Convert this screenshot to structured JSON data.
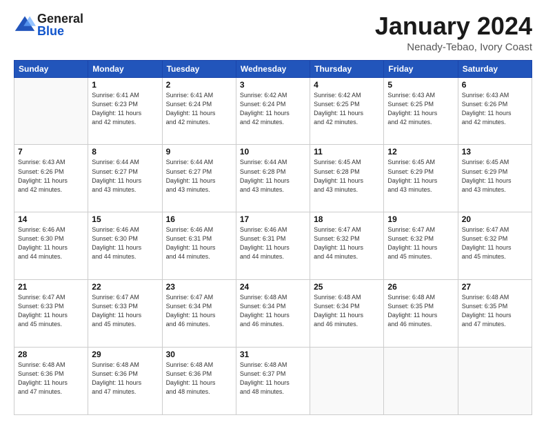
{
  "header": {
    "logo_general": "General",
    "logo_blue": "Blue",
    "month_title": "January 2024",
    "subtitle": "Nenady-Tebao, Ivory Coast"
  },
  "days_of_week": [
    "Sunday",
    "Monday",
    "Tuesday",
    "Wednesday",
    "Thursday",
    "Friday",
    "Saturday"
  ],
  "weeks": [
    [
      {
        "day": "",
        "info": ""
      },
      {
        "day": "1",
        "info": "Sunrise: 6:41 AM\nSunset: 6:23 PM\nDaylight: 11 hours\nand 42 minutes."
      },
      {
        "day": "2",
        "info": "Sunrise: 6:41 AM\nSunset: 6:24 PM\nDaylight: 11 hours\nand 42 minutes."
      },
      {
        "day": "3",
        "info": "Sunrise: 6:42 AM\nSunset: 6:24 PM\nDaylight: 11 hours\nand 42 minutes."
      },
      {
        "day": "4",
        "info": "Sunrise: 6:42 AM\nSunset: 6:25 PM\nDaylight: 11 hours\nand 42 minutes."
      },
      {
        "day": "5",
        "info": "Sunrise: 6:43 AM\nSunset: 6:25 PM\nDaylight: 11 hours\nand 42 minutes."
      },
      {
        "day": "6",
        "info": "Sunrise: 6:43 AM\nSunset: 6:26 PM\nDaylight: 11 hours\nand 42 minutes."
      }
    ],
    [
      {
        "day": "7",
        "info": "Sunrise: 6:43 AM\nSunset: 6:26 PM\nDaylight: 11 hours\nand 42 minutes."
      },
      {
        "day": "8",
        "info": "Sunrise: 6:44 AM\nSunset: 6:27 PM\nDaylight: 11 hours\nand 43 minutes."
      },
      {
        "day": "9",
        "info": "Sunrise: 6:44 AM\nSunset: 6:27 PM\nDaylight: 11 hours\nand 43 minutes."
      },
      {
        "day": "10",
        "info": "Sunrise: 6:44 AM\nSunset: 6:28 PM\nDaylight: 11 hours\nand 43 minutes."
      },
      {
        "day": "11",
        "info": "Sunrise: 6:45 AM\nSunset: 6:28 PM\nDaylight: 11 hours\nand 43 minutes."
      },
      {
        "day": "12",
        "info": "Sunrise: 6:45 AM\nSunset: 6:29 PM\nDaylight: 11 hours\nand 43 minutes."
      },
      {
        "day": "13",
        "info": "Sunrise: 6:45 AM\nSunset: 6:29 PM\nDaylight: 11 hours\nand 43 minutes."
      }
    ],
    [
      {
        "day": "14",
        "info": "Sunrise: 6:46 AM\nSunset: 6:30 PM\nDaylight: 11 hours\nand 44 minutes."
      },
      {
        "day": "15",
        "info": "Sunrise: 6:46 AM\nSunset: 6:30 PM\nDaylight: 11 hours\nand 44 minutes."
      },
      {
        "day": "16",
        "info": "Sunrise: 6:46 AM\nSunset: 6:31 PM\nDaylight: 11 hours\nand 44 minutes."
      },
      {
        "day": "17",
        "info": "Sunrise: 6:46 AM\nSunset: 6:31 PM\nDaylight: 11 hours\nand 44 minutes."
      },
      {
        "day": "18",
        "info": "Sunrise: 6:47 AM\nSunset: 6:32 PM\nDaylight: 11 hours\nand 44 minutes."
      },
      {
        "day": "19",
        "info": "Sunrise: 6:47 AM\nSunset: 6:32 PM\nDaylight: 11 hours\nand 45 minutes."
      },
      {
        "day": "20",
        "info": "Sunrise: 6:47 AM\nSunset: 6:32 PM\nDaylight: 11 hours\nand 45 minutes."
      }
    ],
    [
      {
        "day": "21",
        "info": "Sunrise: 6:47 AM\nSunset: 6:33 PM\nDaylight: 11 hours\nand 45 minutes."
      },
      {
        "day": "22",
        "info": "Sunrise: 6:47 AM\nSunset: 6:33 PM\nDaylight: 11 hours\nand 45 minutes."
      },
      {
        "day": "23",
        "info": "Sunrise: 6:47 AM\nSunset: 6:34 PM\nDaylight: 11 hours\nand 46 minutes."
      },
      {
        "day": "24",
        "info": "Sunrise: 6:48 AM\nSunset: 6:34 PM\nDaylight: 11 hours\nand 46 minutes."
      },
      {
        "day": "25",
        "info": "Sunrise: 6:48 AM\nSunset: 6:34 PM\nDaylight: 11 hours\nand 46 minutes."
      },
      {
        "day": "26",
        "info": "Sunrise: 6:48 AM\nSunset: 6:35 PM\nDaylight: 11 hours\nand 46 minutes."
      },
      {
        "day": "27",
        "info": "Sunrise: 6:48 AM\nSunset: 6:35 PM\nDaylight: 11 hours\nand 47 minutes."
      }
    ],
    [
      {
        "day": "28",
        "info": "Sunrise: 6:48 AM\nSunset: 6:36 PM\nDaylight: 11 hours\nand 47 minutes."
      },
      {
        "day": "29",
        "info": "Sunrise: 6:48 AM\nSunset: 6:36 PM\nDaylight: 11 hours\nand 47 minutes."
      },
      {
        "day": "30",
        "info": "Sunrise: 6:48 AM\nSunset: 6:36 PM\nDaylight: 11 hours\nand 48 minutes."
      },
      {
        "day": "31",
        "info": "Sunrise: 6:48 AM\nSunset: 6:37 PM\nDaylight: 11 hours\nand 48 minutes."
      },
      {
        "day": "",
        "info": ""
      },
      {
        "day": "",
        "info": ""
      },
      {
        "day": "",
        "info": ""
      }
    ]
  ]
}
